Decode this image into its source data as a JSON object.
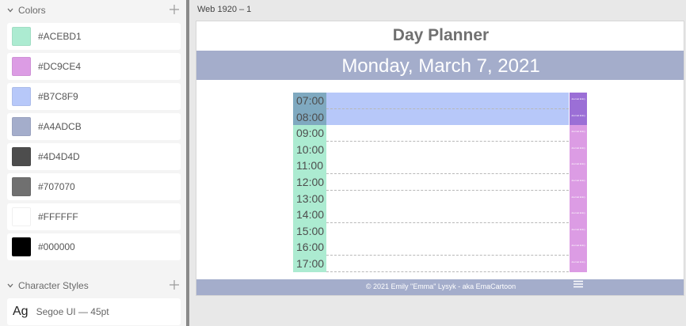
{
  "assets": {
    "colors_title": "Colors",
    "colors": [
      {
        "label": "#ACEBD1",
        "hex": "#ACEBD1"
      },
      {
        "label": "#DC9CE4",
        "hex": "#DC9CE4"
      },
      {
        "label": "#B7C8F9",
        "hex": "#B7C8F9"
      },
      {
        "label": "#A4ADCB",
        "hex": "#A4ADCB"
      },
      {
        "label": "#4D4D4D",
        "hex": "#4D4D4D"
      },
      {
        "label": "#707070",
        "hex": "#707070"
      },
      {
        "label": "#FFFFFF",
        "hex": "#FFFFFF"
      },
      {
        "label": "#000000",
        "hex": "#000000"
      }
    ],
    "char_styles_title": "Character Styles",
    "char_style": {
      "sample": "Ag",
      "description": "Segoe UI — 45pt"
    }
  },
  "artboard": {
    "label": "Web 1920 – 1",
    "title": "Day Planner",
    "date": "Monday, March 7, 2021",
    "footer": "© 2021 Emily \"Emma\" Lysyk - aka EmaCartoon",
    "hours": [
      {
        "label": "07:00",
        "state": "past"
      },
      {
        "label": "08:00",
        "state": "present"
      },
      {
        "label": "09:00",
        "state": "future"
      },
      {
        "label": "10:00",
        "state": "future"
      },
      {
        "label": "11:00",
        "state": "future"
      },
      {
        "label": "12:00",
        "state": "future"
      },
      {
        "label": "13:00",
        "state": "future"
      },
      {
        "label": "14:00",
        "state": "future"
      },
      {
        "label": "15:00",
        "state": "future"
      },
      {
        "label": "16:00",
        "state": "future"
      },
      {
        "label": "17:00",
        "state": "future"
      }
    ],
    "save_button_text": "Journal Entry",
    "colors": {
      "past_label": "#7FA9C0",
      "past_fill": "#B7C8F9",
      "present_label": "#7FA9C0",
      "present_fill": "#B7C8F9",
      "future_label": "#ACEBD1",
      "future_fill": "#FFFFFF",
      "btn_active": "#9B6FD6",
      "btn_future": "#DC9CE4"
    },
    "icons": {
      "menu": "hamburger-menu-icon"
    }
  }
}
